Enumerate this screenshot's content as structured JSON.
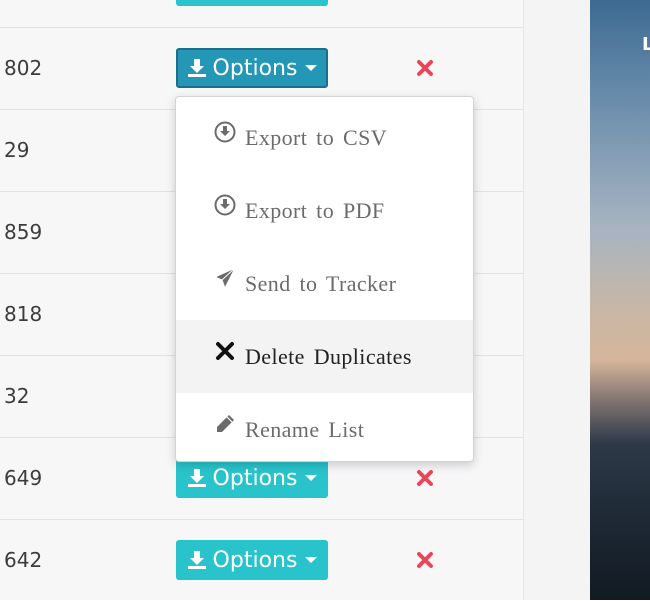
{
  "table": {
    "options_label": "Options",
    "rows": [
      {
        "count": ""
      },
      {
        "count": "802"
      },
      {
        "count": "29"
      },
      {
        "count": "859"
      },
      {
        "count": "818"
      },
      {
        "count": "32"
      },
      {
        "count": "649"
      },
      {
        "count": "642"
      }
    ]
  },
  "dropdown": {
    "items": [
      {
        "label": "Export to CSV",
        "icon": "download-circle-icon"
      },
      {
        "label": "Export to PDF",
        "icon": "download-circle-icon"
      },
      {
        "label": "Send to Tracker",
        "icon": "send-icon"
      },
      {
        "label": "Delete Duplicates",
        "icon": "close-icon"
      },
      {
        "label": "Rename List",
        "icon": "pencil-icon"
      }
    ]
  },
  "side_photo": {
    "letter": "L"
  },
  "colors": {
    "button": "#29c4cb",
    "button_active": "#2496b6",
    "delete": "#e8475b"
  }
}
